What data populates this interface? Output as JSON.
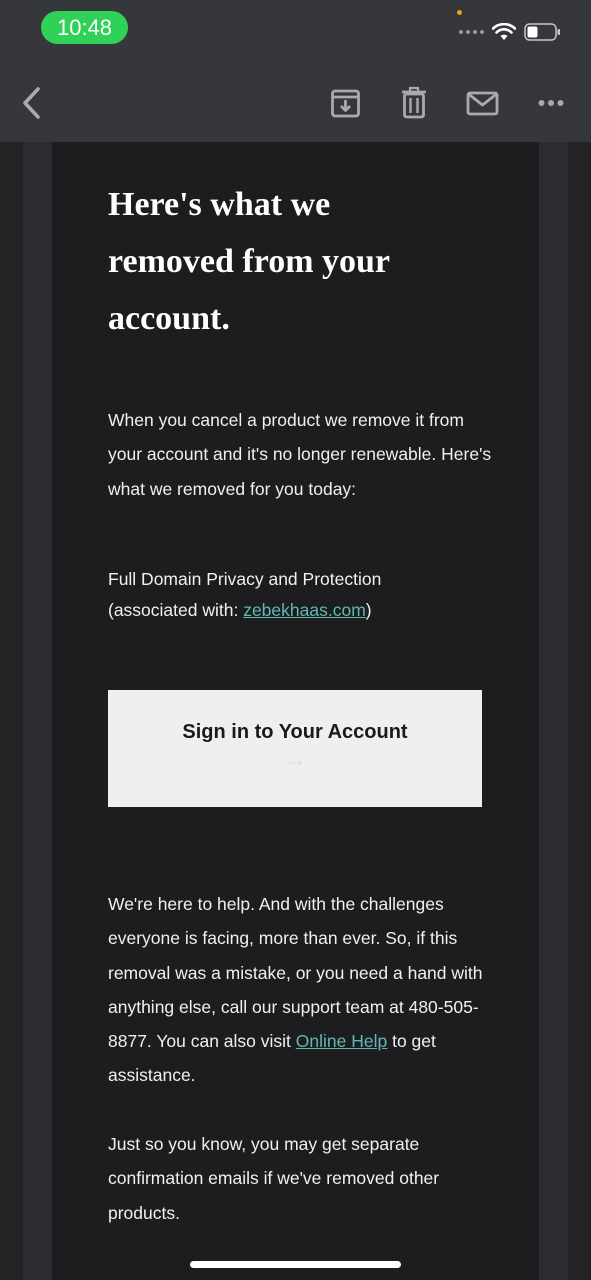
{
  "status_bar": {
    "time": "10:48"
  },
  "toolbar": {
    "back_icon": "chevron-left-icon",
    "archive_icon": "archive-icon",
    "trash_icon": "trash-icon",
    "mail_icon": "envelope-icon",
    "more_icon": "more-icon"
  },
  "email": {
    "headline": "Here's what we removed from your account.",
    "intro": "When you cancel a product we remove it from your account and it's no longer renewable. Here's what we removed for you today:",
    "product_name": "Full Domain Privacy and Protection",
    "associated_prefix": "(associated with: ",
    "domain": "zebekhaas.com",
    "associated_suffix": ")",
    "cta_label": "Sign in to Your Account",
    "cta_arrow": "→",
    "help_text_before": "We're here to help. And with the challenges everyone is facing, more than ever. So, if this removal was a mistake, or you need a hand with anything else, call our support team at 480-505-8877. You can also visit ",
    "help_link": "Online Help",
    "help_text_after": " to get assistance.",
    "footer_note": "Just so you know, you may get separate confirmation emails if we've removed other products."
  },
  "colors": {
    "toolbar_bg": "#36373a",
    "content_bg": "#1d1d20",
    "link": "#5fb8b2",
    "status_pill": "#30d158",
    "cta_bg": "#efefef"
  }
}
